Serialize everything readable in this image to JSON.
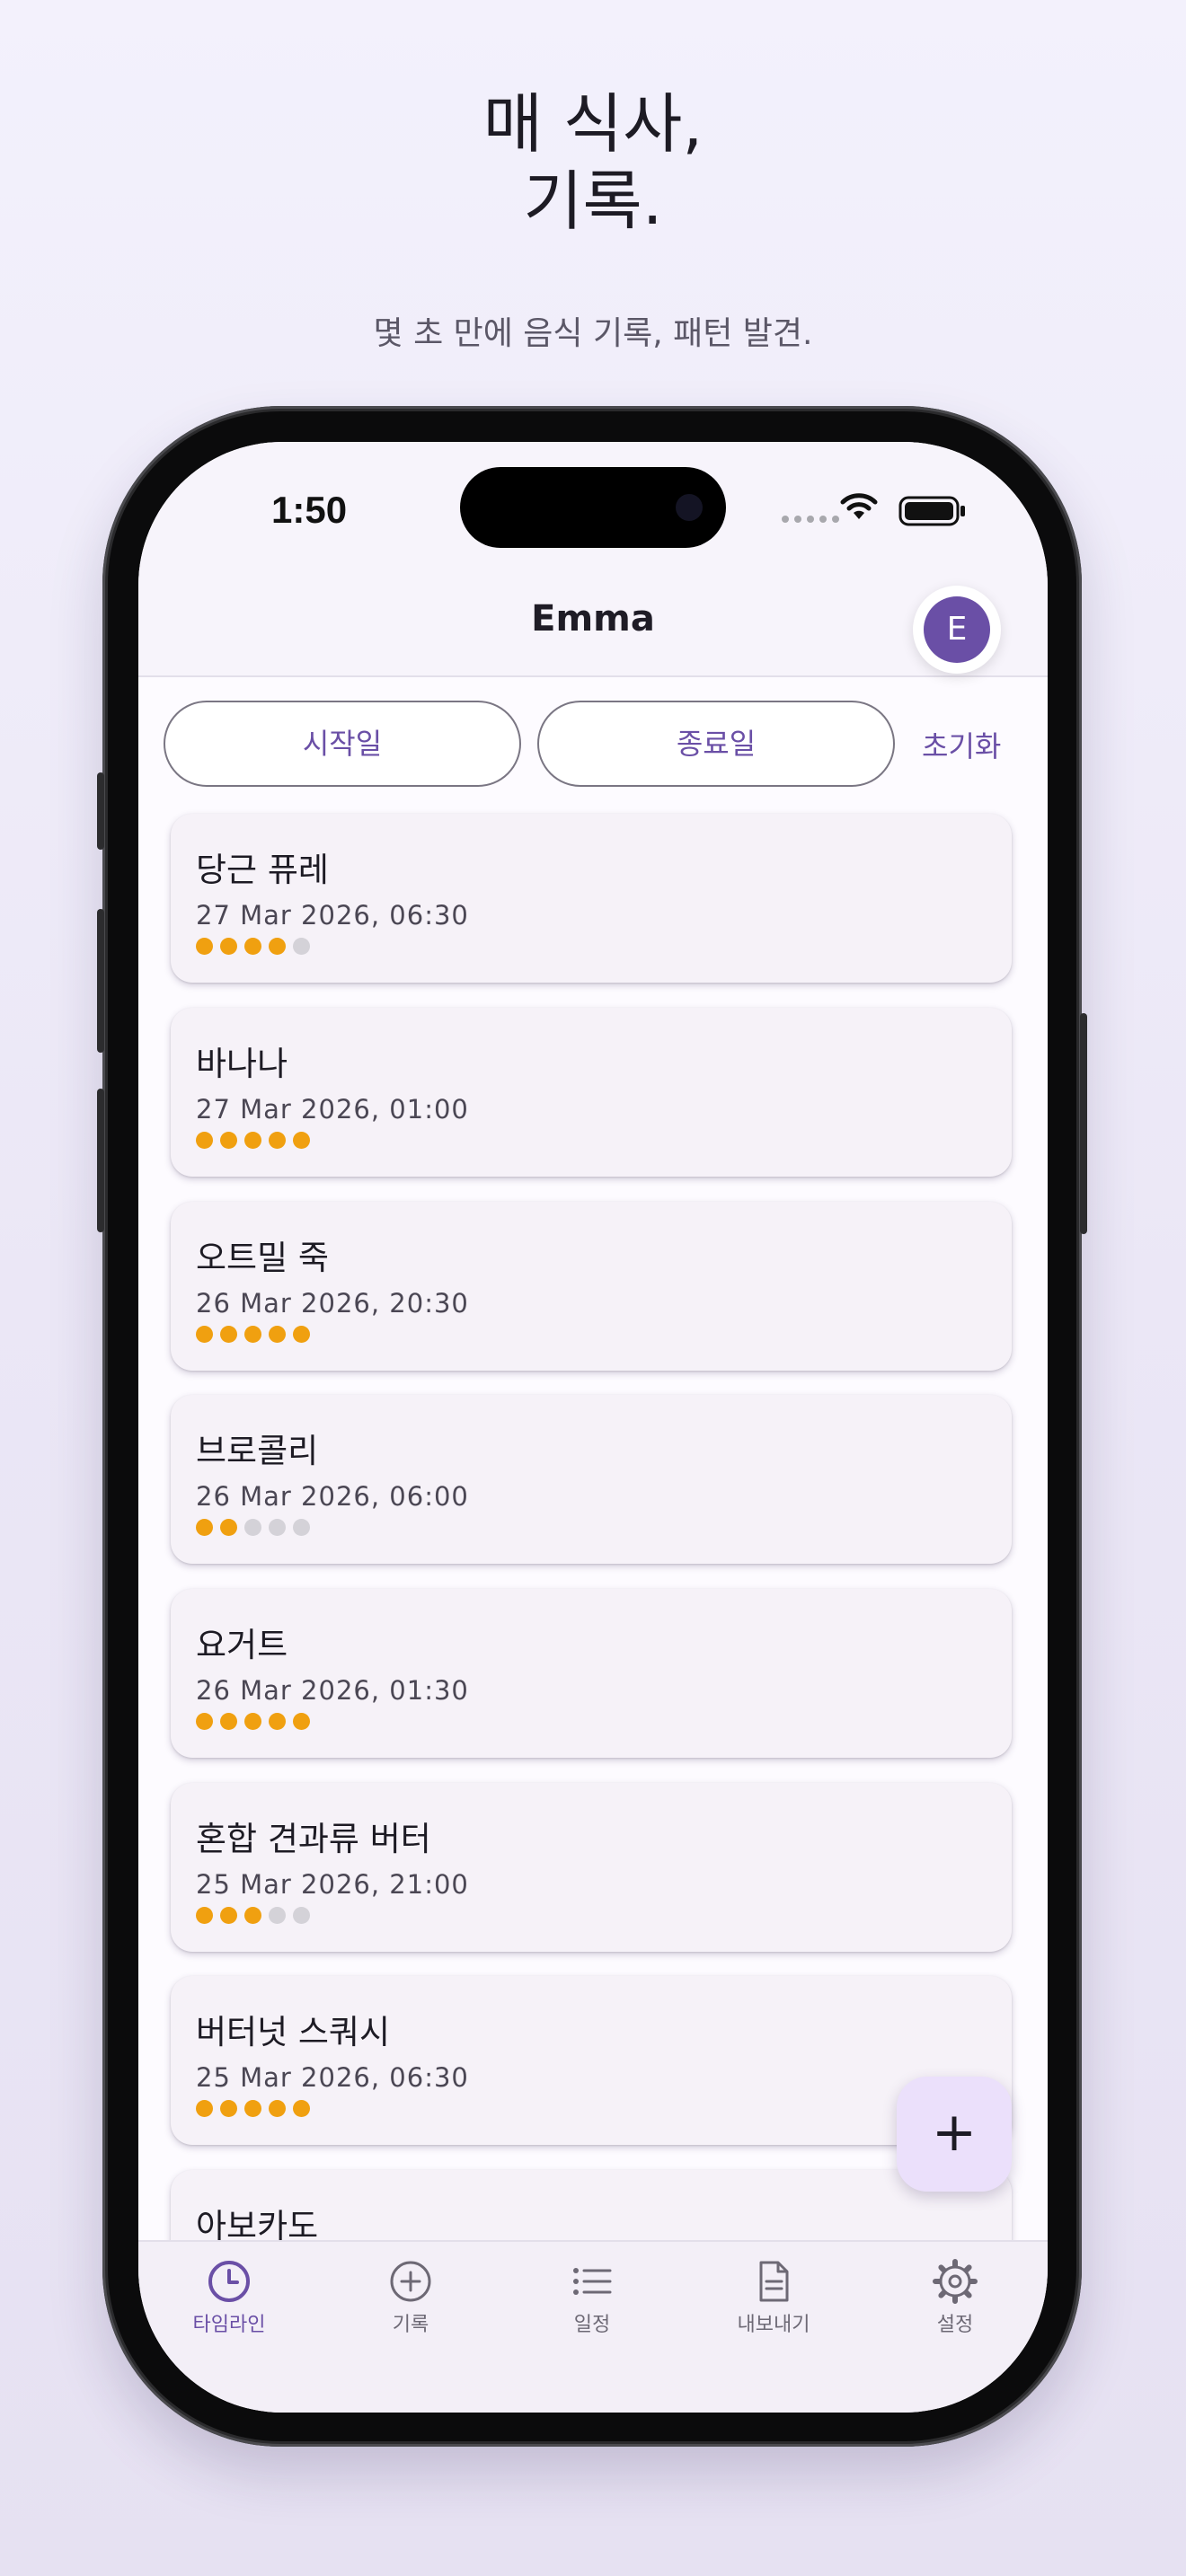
{
  "promo": {
    "headline_line1": "매 식사,",
    "headline_line2": "기록.",
    "subhead": "몇 초 만에 음식 기록, 패턴 발견."
  },
  "status_bar": {
    "time": "1:50"
  },
  "header": {
    "title": "Emma",
    "avatar_initial": "E"
  },
  "filters": {
    "start_label": "시작일",
    "end_label": "종료일",
    "reset_label": "초기화"
  },
  "entries": [
    {
      "name": "당근 퓨레",
      "date": "27 Mar 2026, 06:30",
      "rating": 4
    },
    {
      "name": "바나나",
      "date": "27 Mar 2026, 01:00",
      "rating": 5
    },
    {
      "name": "오트밀 죽",
      "date": "26 Mar 2026, 20:30",
      "rating": 5
    },
    {
      "name": "브로콜리",
      "date": "26 Mar 2026, 06:00",
      "rating": 2
    },
    {
      "name": "요거트",
      "date": "26 Mar 2026, 01:30",
      "rating": 5
    },
    {
      "name": "혼합 견과류 버터",
      "date": "25 Mar 2026, 21:00",
      "rating": 3
    },
    {
      "name": "버터넛 스쿼시",
      "date": "25 Mar 2026, 06:30",
      "rating": 5
    },
    {
      "name": "아보카도",
      "date": "",
      "rating": 0
    }
  ],
  "rating_max": 5,
  "fab": {
    "label": "+"
  },
  "tabs": [
    {
      "label": "타임라인",
      "icon": "clock-icon",
      "active": true
    },
    {
      "label": "기록",
      "icon": "plus-circle-icon",
      "active": false
    },
    {
      "label": "일정",
      "icon": "list-icon",
      "active": false
    },
    {
      "label": "내보내기",
      "icon": "document-icon",
      "active": false
    },
    {
      "label": "설정",
      "icon": "gear-icon",
      "active": false
    }
  ],
  "colors": {
    "accent": "#6a4fa6",
    "rating_on": "#f0a010",
    "rating_off": "#d4d2d8",
    "fab_bg": "#ebe0fb"
  }
}
